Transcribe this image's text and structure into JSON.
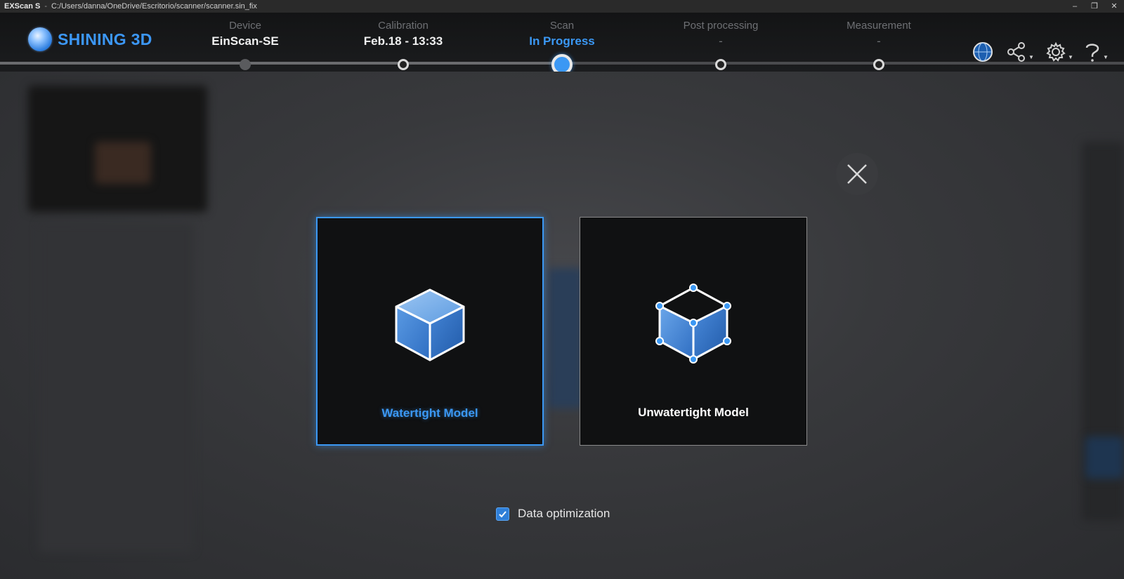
{
  "window": {
    "app_name": "EXScan S",
    "separator": "-",
    "file_path": "C:/Users/danna/OneDrive/Escritorio/scanner/scanner.sin_fix",
    "controls": [
      "–",
      "❐",
      "✕"
    ]
  },
  "header": {
    "brand": "SHINING 3D",
    "steps": [
      {
        "label": "Device",
        "value": "EinScan-SE",
        "state": "done"
      },
      {
        "label": "Calibration",
        "value": "Feb.18 - 13:33",
        "state": "done"
      },
      {
        "label": "Scan",
        "value": "In Progress",
        "state": "current"
      },
      {
        "label": "Post processing",
        "value": "-",
        "state": "pending"
      },
      {
        "label": "Measurement",
        "value": "-",
        "state": "pending"
      }
    ],
    "icons": [
      "globe-icon",
      "share-icon",
      "settings-icon",
      "help-icon"
    ]
  },
  "dialog": {
    "options": [
      {
        "title": "Watertight Model",
        "selected": true,
        "icon": "solid-cube-icon"
      },
      {
        "title": "Unwatertight Model",
        "selected": false,
        "icon": "open-cube-icon"
      }
    ],
    "checkbox": {
      "label": "Data optimization",
      "checked": true
    },
    "close_icon": "close-icon"
  },
  "colors": {
    "accent": "#3b98f4",
    "background": "#2b2c2f",
    "header": "#141516"
  }
}
